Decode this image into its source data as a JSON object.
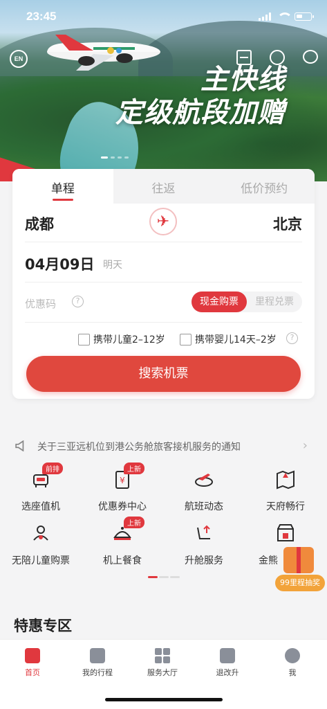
{
  "status": {
    "time": "23:45"
  },
  "hero": {
    "lang_button": "EN",
    "slogan_line1": "主快线",
    "slogan_line2": "定级航段加赠"
  },
  "booking": {
    "tabs": [
      "单程",
      "往返",
      "低价预约"
    ],
    "active_tab": 0,
    "from_city": "成都",
    "to_city": "北京",
    "date": "04月09日",
    "date_hint": "明天",
    "promo_label": "优惠码",
    "pay_options": [
      "现金购票",
      "里程兑票"
    ],
    "active_pay": 0,
    "child_option": "携带儿童2–12岁",
    "infant_option": "携带婴儿14天–2岁",
    "search_button": "搜索机票"
  },
  "notice": {
    "text": "关于三亚远机位到港公务舱旅客接机服务的通知"
  },
  "services": [
    {
      "label": "选座值机",
      "icon": "seat-checkin-icon",
      "badge": "前排"
    },
    {
      "label": "优惠券中心",
      "icon": "coupon-icon",
      "badge": "上新"
    },
    {
      "label": "航班动态",
      "icon": "flight-status-icon",
      "badge": ""
    },
    {
      "label": "天府畅行",
      "icon": "map-icon",
      "badge": ""
    },
    {
      "label": "无陪儿童购票",
      "icon": "child-icon",
      "badge": ""
    },
    {
      "label": "机上餐食",
      "icon": "meal-icon",
      "badge": "上新"
    },
    {
      "label": "升舱服务",
      "icon": "upgrade-icon",
      "badge": ""
    },
    {
      "label": "金熊",
      "icon": "store-icon",
      "badge": ""
    }
  ],
  "float_ad": {
    "label": "99里程抽奖"
  },
  "section": {
    "title": "特惠专区"
  },
  "nav": [
    {
      "label": "首页",
      "icon": "home-icon"
    },
    {
      "label": "我的行程",
      "icon": "trip-icon"
    },
    {
      "label": "服务大厅",
      "icon": "grid-icon"
    },
    {
      "label": "退改升",
      "icon": "change-icon"
    },
    {
      "label": "我",
      "icon": "profile-icon"
    }
  ],
  "colors": {
    "brand_red": "#e0383e"
  }
}
